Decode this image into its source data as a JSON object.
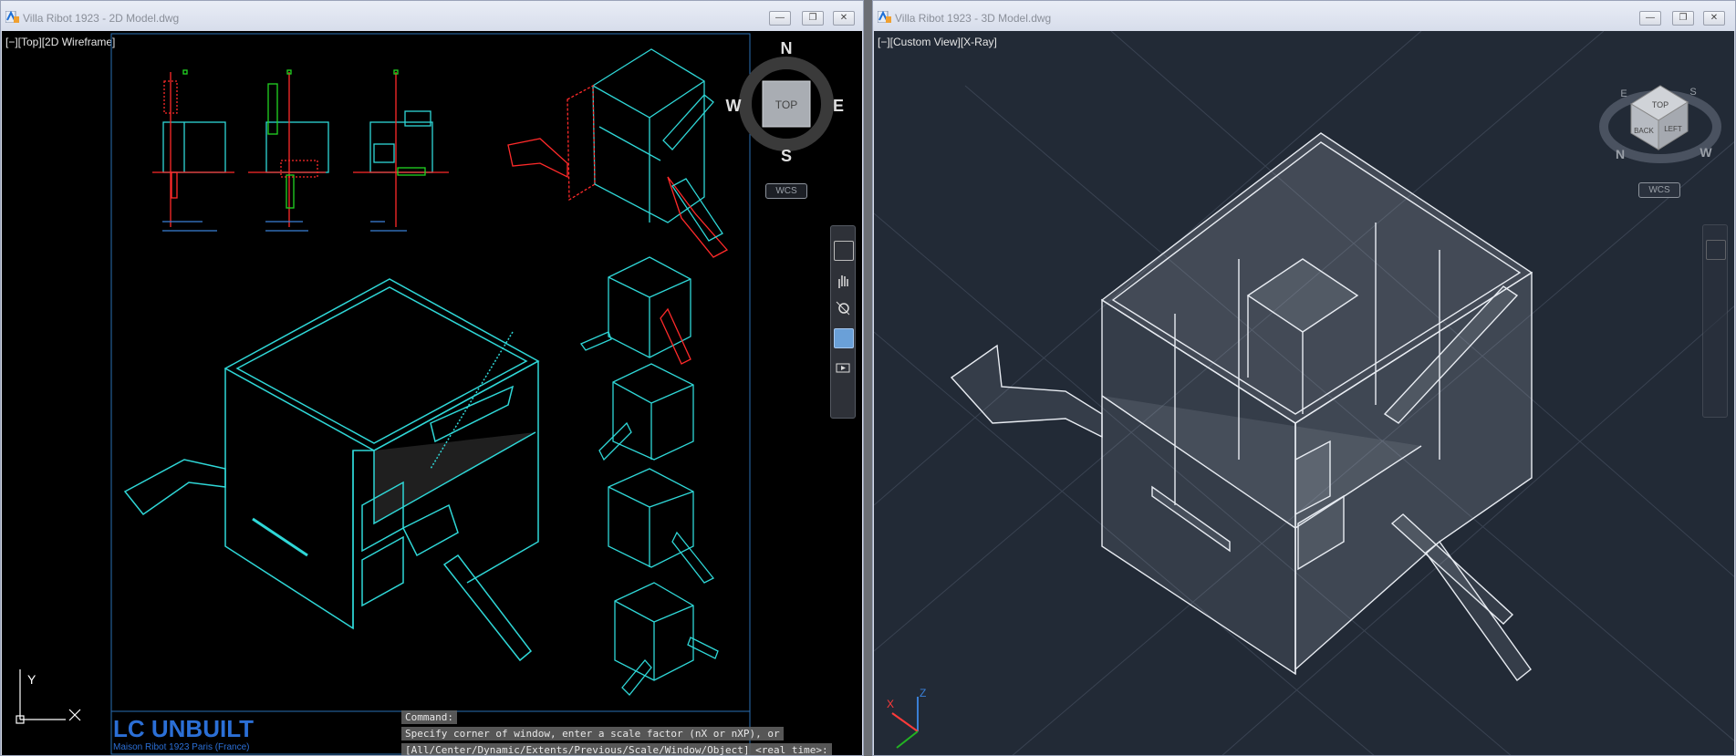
{
  "left_window": {
    "title": "Villa Ribot 1923 - 2D Model.dwg",
    "viewport_label": "[−][Top][2D Wireframe]",
    "compass": {
      "n": "N",
      "s": "S",
      "e": "E",
      "w": "W",
      "center": "TOP"
    },
    "wcs": "WCS",
    "ucs": {
      "x": "X",
      "y": "Y"
    },
    "logo": {
      "brand": "LC UNBUILT",
      "subtitle": "Maison Ribot 1923 Paris (France)"
    },
    "command_lines": [
      "Command:",
      "Specify corner of window, enter a scale factor (nX or nXP), or",
      "[All/Center/Dynamic/Extents/Previous/Scale/Window/Object] <real time>:"
    ],
    "colors": {
      "line": "#2fd7d7",
      "red": "#ff2a2a",
      "green": "#22d422",
      "blue": "#3a7fd6",
      "background": "#000000"
    }
  },
  "right_window": {
    "title": "Villa Ribot 1923 - 3D Model.dwg",
    "viewport_label": "[−][Custom View][X-Ray]",
    "viewcube": {
      "top": "TOP",
      "back": "BACK",
      "left": "LEFT",
      "s": "S",
      "n": "N",
      "w": "W",
      "e": "E"
    },
    "wcs": "WCS",
    "axis": {
      "x": "X",
      "z": "Z"
    },
    "colors": {
      "line": "#e8ecf2",
      "background": "#222a36"
    }
  },
  "window_buttons": {
    "minimize": "—",
    "restore": "❐",
    "close": "✕"
  }
}
